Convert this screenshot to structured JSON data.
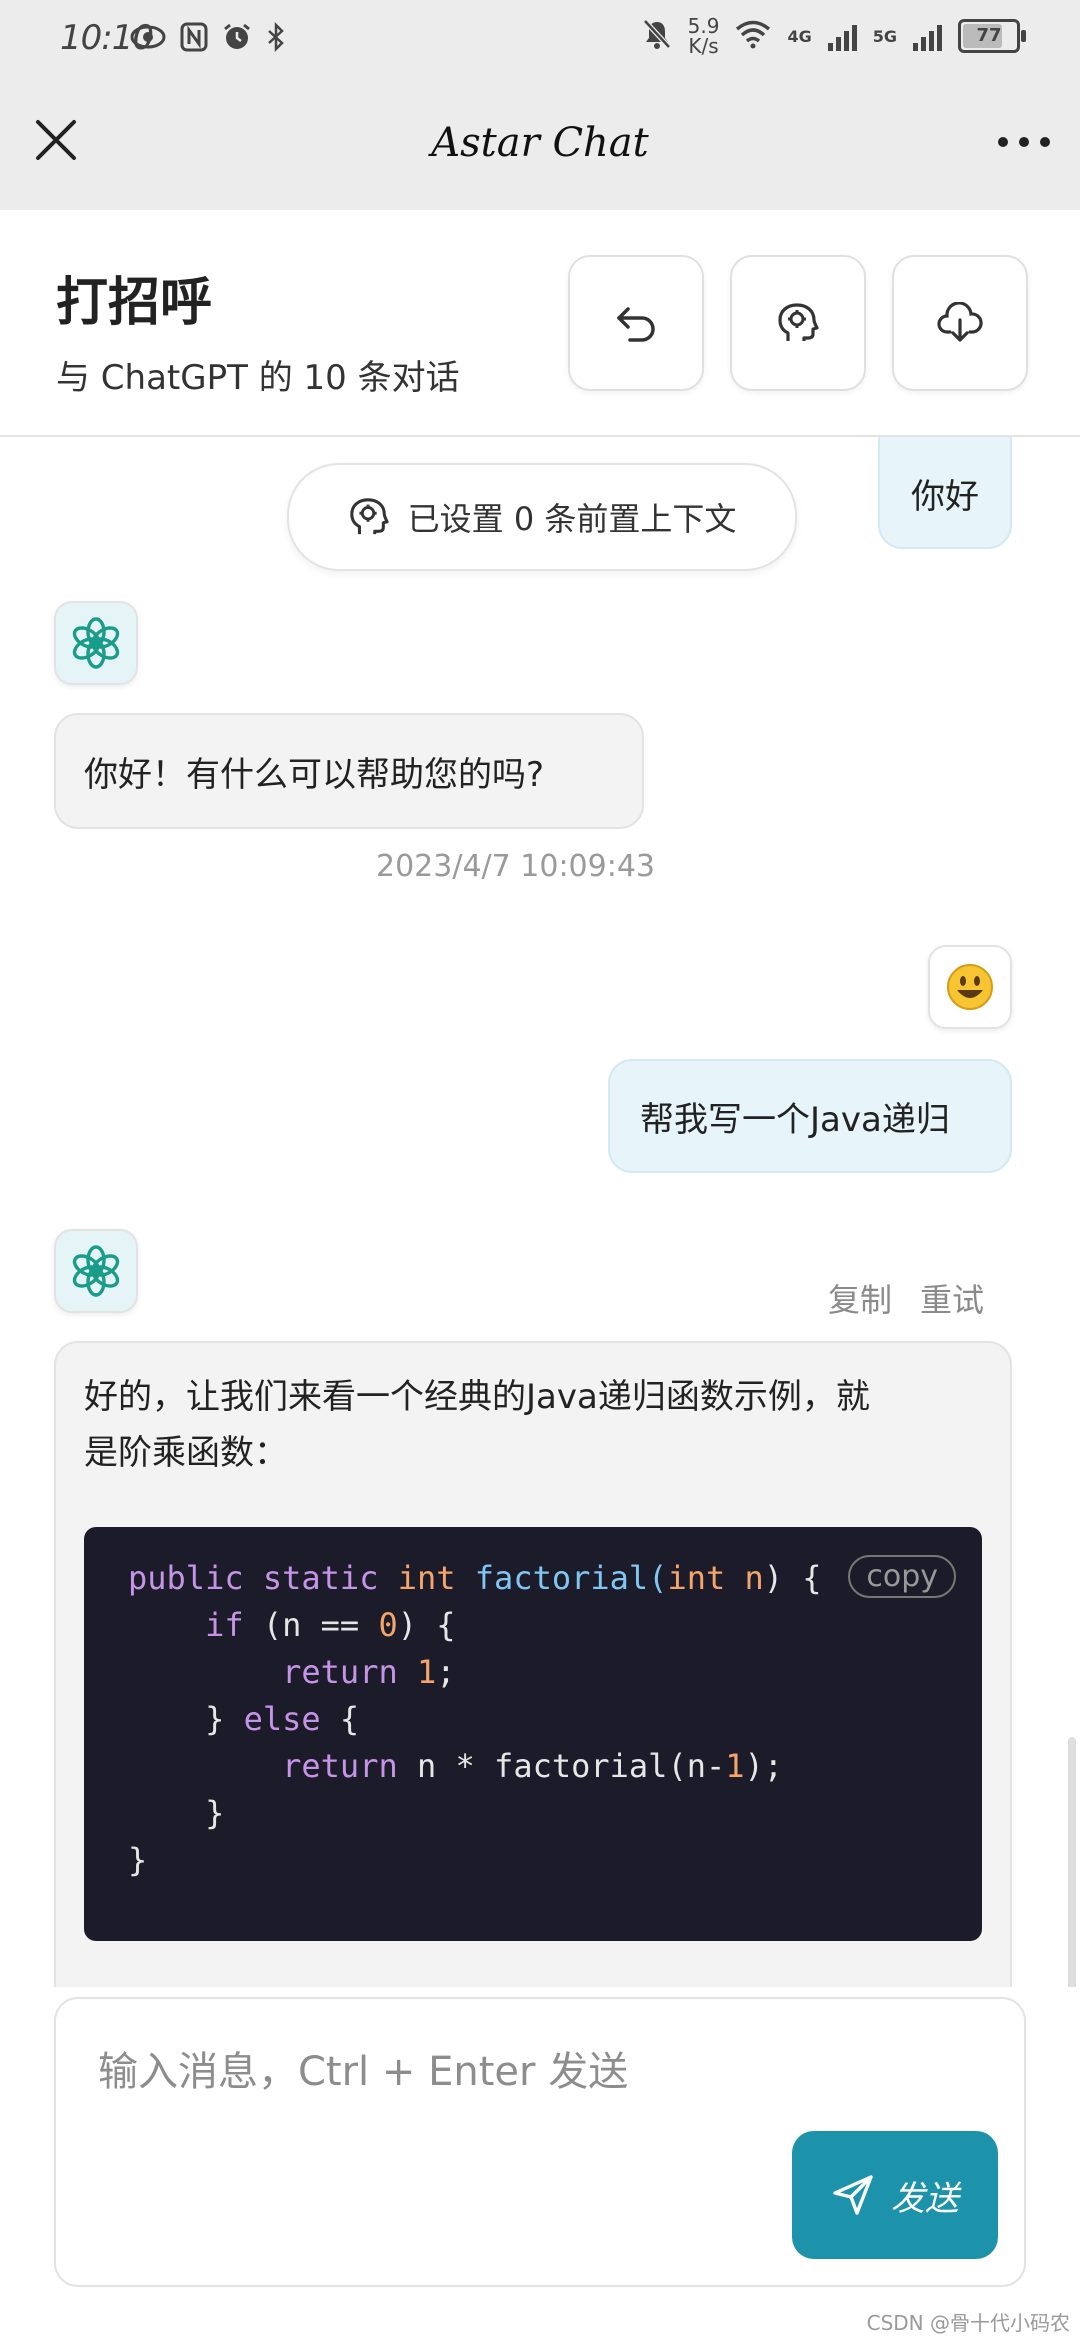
{
  "status_bar": {
    "time": "10:10",
    "speed_value": "5.9",
    "speed_unit": "K/s",
    "network_1": "4G",
    "network_2": "5G",
    "battery": "77",
    "battery_level": 0.77
  },
  "app_bar": {
    "title": "Astar Chat"
  },
  "chat_header": {
    "title": "打招呼",
    "subtitle": "与 ChatGPT 的 10 条对话"
  },
  "context_pill": {
    "label": "已设置 0 条前置上下文"
  },
  "messages": [
    {
      "role": "user",
      "text": "你好"
    },
    {
      "role": "assistant",
      "text": "你好！有什么可以帮助您的吗?",
      "timestamp": "2023/4/7 10:09:43"
    },
    {
      "role": "user",
      "text": "帮我写一个Java递归"
    },
    {
      "role": "assistant",
      "actions": {
        "copy": "复制",
        "retry": "重试"
      },
      "text_line_1": "好的，让我们来看一个经典的Java递归函数示例，就",
      "text_line_2": "是阶乘函数：",
      "code": {
        "copy_label": "copy",
        "lines": [
          "public static int factorial(int n) {",
          "    if (n == 0) {",
          "        return 1;",
          "    } else {",
          "        return n * factorial(n-1);",
          "    }",
          "}"
        ]
      }
    }
  ],
  "input": {
    "placeholder": "输入消息，Ctrl + Enter 发送",
    "send_label": "发送"
  },
  "watermark": "CSDN @骨十代小码农"
}
